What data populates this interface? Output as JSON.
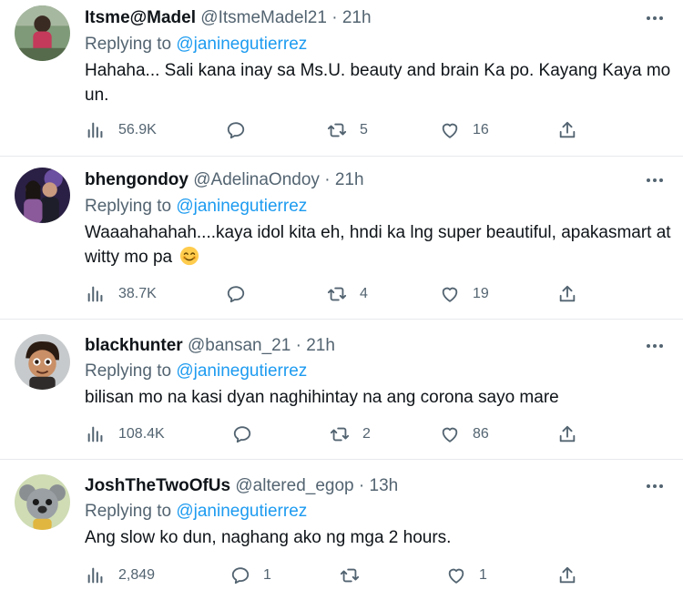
{
  "tweets": [
    {
      "display_name": "Itsme@Madel",
      "handle": "@ItsmeMadel21",
      "separator": "·",
      "time": "21h",
      "replying_prefix": "Replying to",
      "replying_to": "@janinegutierrez",
      "text": "Hahaha... Sali kana inay sa Ms.U. beauty and brain Ka po.  Kayang Kaya mo un.",
      "views": "56.9K",
      "replies": "",
      "retweets": "5",
      "likes": "16",
      "avatar_color": "#6b8a5e"
    },
    {
      "display_name": "bhengondoy",
      "handle": "@AdelinaOndoy",
      "separator": "·",
      "time": "21h",
      "replying_prefix": "Replying to",
      "replying_to": "@janinegutierrez",
      "text": "Waaahahahah....kaya idol kita eh, hndi ka lng super beautiful, apakasmart at witty mo pa",
      "views": "38.7K",
      "replies": "",
      "retweets": "4",
      "likes": "19",
      "avatar_color": "#3a2a5a"
    },
    {
      "display_name": "blackhunter",
      "handle": "@bansan_21",
      "separator": "·",
      "time": "21h",
      "replying_prefix": "Replying to",
      "replying_to": "@janinegutierrez",
      "text": "bilisan mo na kasi dyan naghihintay na ang corona sayo mare",
      "views": "108.4K",
      "replies": "",
      "retweets": "2",
      "likes": "86",
      "avatar_color": "#b5b8bb"
    },
    {
      "display_name": "JoshTheTwoOfUs",
      "handle": "@altered_egop",
      "separator": "·",
      "time": "13h",
      "replying_prefix": "Replying to",
      "replying_to": "@janinegutierrez",
      "text": "Ang slow ko dun, naghang ako ng mga 2 hours.",
      "views": "2,849",
      "replies": "1",
      "retweets": "",
      "likes": "1",
      "avatar_color": "#c9d6b0"
    }
  ],
  "colors": {
    "accent": "#1d9bf0",
    "secondary_text": "#536471",
    "primary_text": "#0f1419",
    "divider": "#e6e9ec"
  },
  "icons": {
    "views": "bar-chart-icon",
    "reply": "speech-bubble-icon",
    "retweet": "retweet-icon",
    "like": "heart-icon",
    "share": "share-upload-icon",
    "more": "more-dots-icon",
    "emoji": "smiling-face-emoji"
  }
}
